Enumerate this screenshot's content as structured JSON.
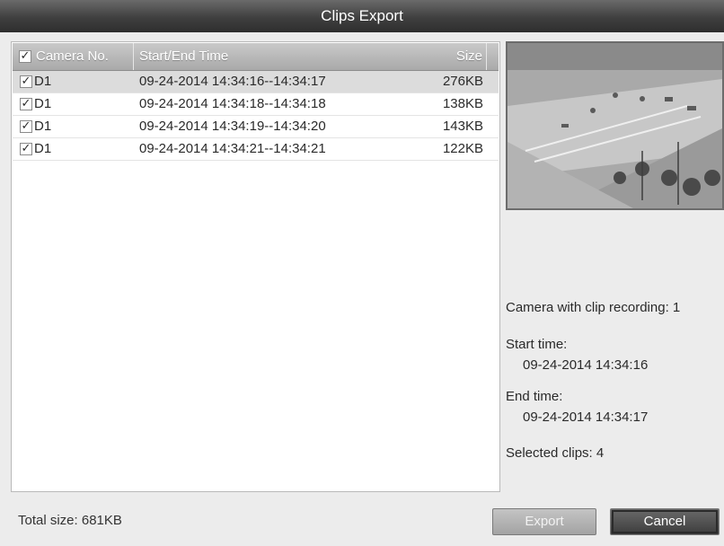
{
  "window": {
    "title": "Clips Export"
  },
  "table": {
    "header_checked": "✓",
    "columns": {
      "camera": "Camera No.",
      "time": "Start/End Time",
      "size": "Size"
    },
    "rows": [
      {
        "checked": "✓",
        "camera": "D1",
        "time": "09-24-2014 14:34:16--14:34:17",
        "size": "276KB",
        "selected": true
      },
      {
        "checked": "✓",
        "camera": "D1",
        "time": "09-24-2014 14:34:18--14:34:18",
        "size": "138KB",
        "selected": false
      },
      {
        "checked": "✓",
        "camera": "D1",
        "time": "09-24-2014 14:34:19--14:34:20",
        "size": "143KB",
        "selected": false
      },
      {
        "checked": "✓",
        "camera": "D1",
        "time": "09-24-2014 14:34:21--14:34:21",
        "size": "122KB",
        "selected": false
      }
    ]
  },
  "info": {
    "camera_count": "Camera with clip recording: 1",
    "start_label": "Start time:",
    "start_value": "09-24-2014 14:34:16",
    "end_label": "End time:",
    "end_value": "09-24-2014 14:34:17",
    "selected": "Selected clips: 4"
  },
  "footer": {
    "total": "Total size: 681KB",
    "export_label": "Export",
    "cancel_label": "Cancel"
  }
}
